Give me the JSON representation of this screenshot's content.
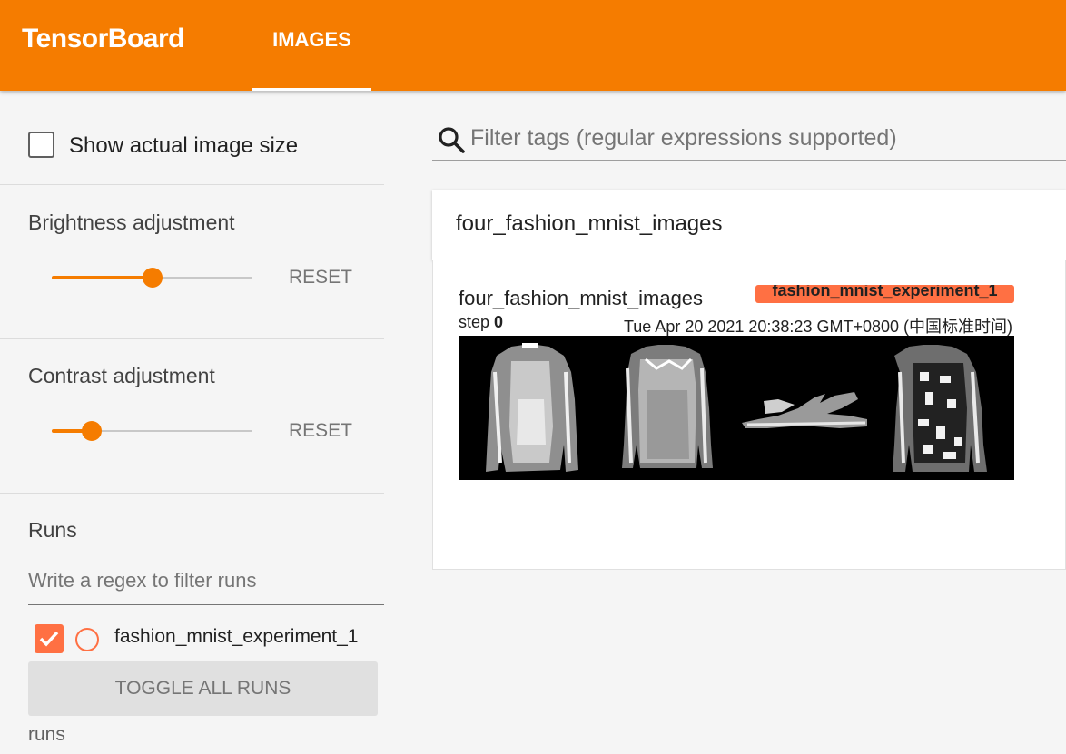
{
  "header": {
    "brand": "TensorBoard",
    "tabs": [
      {
        "label": "IMAGES",
        "active": true
      }
    ],
    "color": "#f57c00"
  },
  "sidebar": {
    "actual_size": {
      "label": "Show actual image size",
      "checked": false
    },
    "brightness": {
      "title": "Brightness adjustment",
      "value": 0.5,
      "reset_label": "RESET"
    },
    "contrast": {
      "title": "Contrast adjustment",
      "value": 0.2,
      "reset_label": "RESET"
    },
    "runs": {
      "title": "Runs",
      "filter_placeholder": "Write a regex to filter runs",
      "items": [
        {
          "name": "fashion_mnist_experiment_1",
          "checked": true,
          "color": "#ff7043"
        }
      ],
      "toggle_label": "TOGGLE ALL RUNS",
      "footer": "runs"
    }
  },
  "main": {
    "search": {
      "placeholder": "Filter tags (regular expressions supported)",
      "icon": "search-icon"
    },
    "tag_group": {
      "title": "four_fashion_mnist_images",
      "card": {
        "title": "four_fashion_mnist_images",
        "run": "fashion_mnist_experiment_1",
        "step_label": "step",
        "step": "0",
        "timestamp": "Tue Apr 20 2021 20:38:23 GMT+0800 (中国标准时间)",
        "image_alt": "fashion-mnist grid"
      }
    }
  }
}
